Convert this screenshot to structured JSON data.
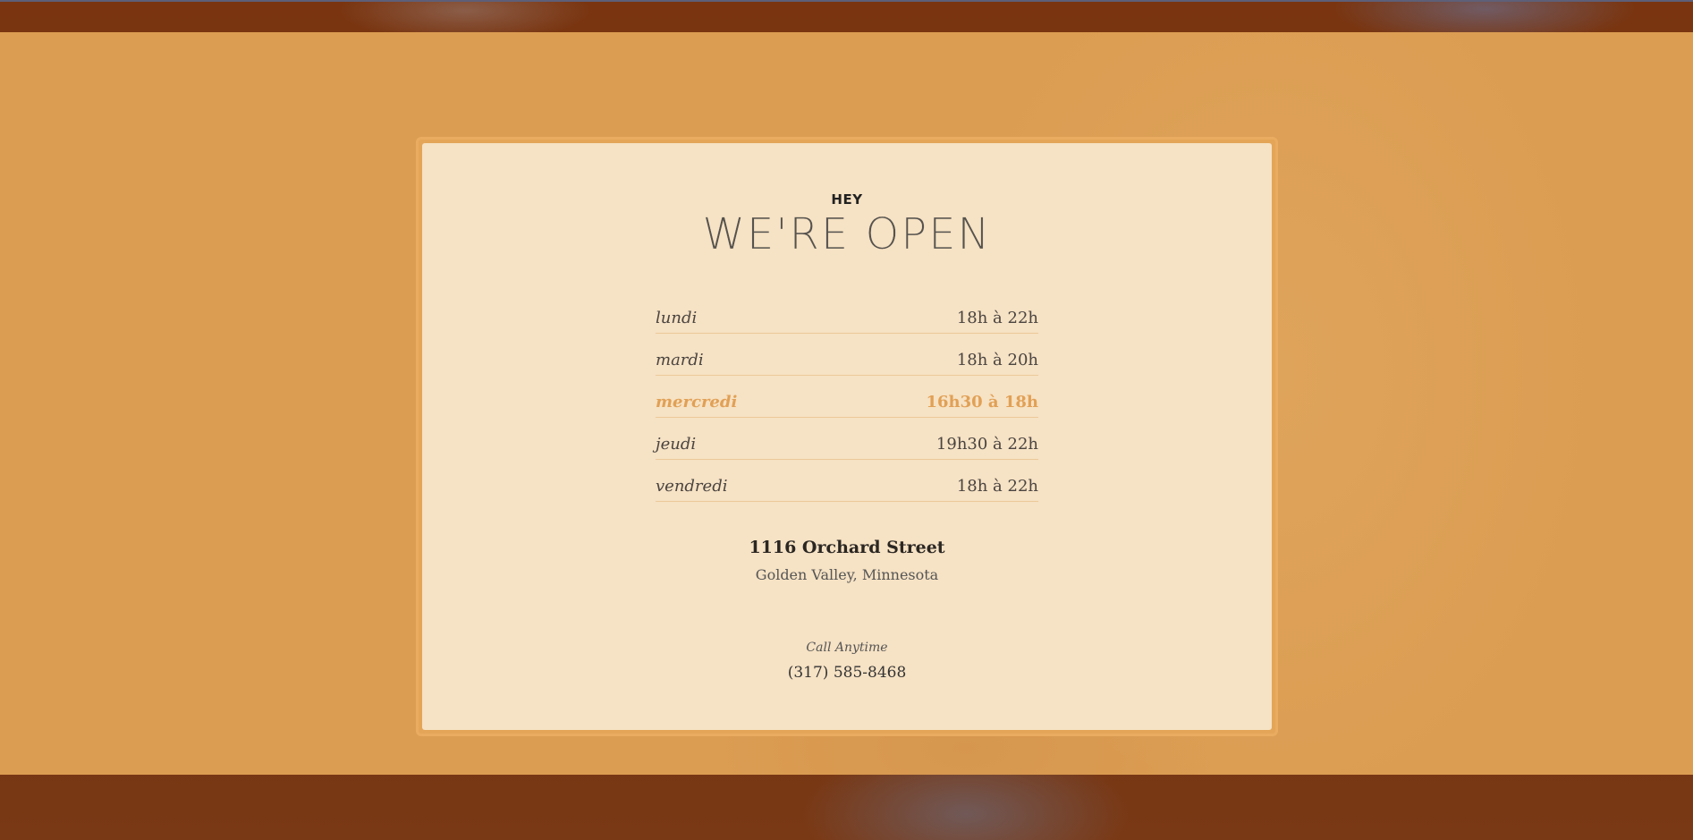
{
  "header": {
    "kicker": "HEY",
    "title": "WE'RE OPEN"
  },
  "hours": [
    {
      "day": "lundi",
      "time": "18h à 22h",
      "highlighted": false
    },
    {
      "day": "mardi",
      "time": "18h à 20h",
      "highlighted": false
    },
    {
      "day": "mercredi",
      "time": "16h30 à 18h",
      "highlighted": true
    },
    {
      "day": "jeudi",
      "time": "19h30 à 22h",
      "highlighted": false
    },
    {
      "day": "vendredi",
      "time": "18h à 22h",
      "highlighted": false
    }
  ],
  "address": {
    "street": "1116 Orchard Street",
    "city": "Golden Valley, Minnesota"
  },
  "contact": {
    "label": "Call Anytime",
    "phone": "(317) 585-8468"
  },
  "colors": {
    "band": "#db9d52",
    "card": "#f6e2c4",
    "highlight": "#e1a055"
  }
}
